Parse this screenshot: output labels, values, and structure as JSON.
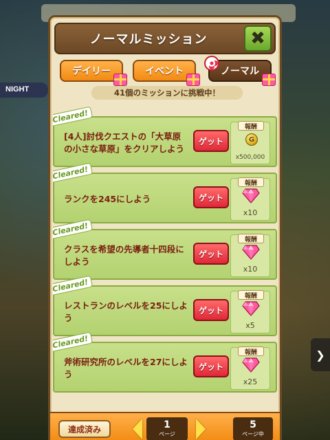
{
  "panel": {
    "title": "ノーマルミッション",
    "close_symbol": "✖",
    "tabs": [
      {
        "label": "デイリー",
        "active": false
      },
      {
        "label": "イベント",
        "active": false
      },
      {
        "label": "ノーマル",
        "active": true
      }
    ],
    "challenge_text": "41個のミッションに挑戦中！"
  },
  "background": {
    "night_label": "NIGHT"
  },
  "missions": [
    {
      "cleared_label": "Cleared!",
      "text": "[4人]討伐クエストの「大草原の小さな草原」をクリアしよう",
      "button": "ゲット",
      "reward_label": "報酬",
      "reward_icon": "coin-icon",
      "reward_qty": "x500,000",
      "coin_letter": "G"
    },
    {
      "cleared_label": "Cleared!",
      "text": "ランクを245にしよう",
      "button": "ゲット",
      "reward_label": "報酬",
      "reward_icon": "gem-icon",
      "reward_qty": "x10"
    },
    {
      "cleared_label": "Cleared!",
      "text": "クラスを希望の先導者十四段にしよう",
      "button": "ゲット",
      "reward_label": "報酬",
      "reward_icon": "gem-icon",
      "reward_qty": "x10"
    },
    {
      "cleared_label": "Cleared!",
      "text": "レストランのレベルを25にしよう",
      "button": "ゲット",
      "reward_label": "報酬",
      "reward_icon": "gem-icon",
      "reward_qty": "x5"
    },
    {
      "cleared_label": "Cleared!",
      "text": "斧術研究所のレベルを27にしよう",
      "button": "ゲット",
      "reward_label": "報酬",
      "reward_icon": "gem-icon",
      "reward_qty": "x25"
    }
  ],
  "footer": {
    "done_label": "達成済み",
    "current_page": "1",
    "page_unit": "ページ",
    "total_pages": "5",
    "total_unit": "ページ中"
  },
  "colors": {
    "accent_orange": "#f28a12",
    "header_brown": "#6c4826",
    "mission_green": "#c8e08a",
    "get_red": "#e02838"
  }
}
